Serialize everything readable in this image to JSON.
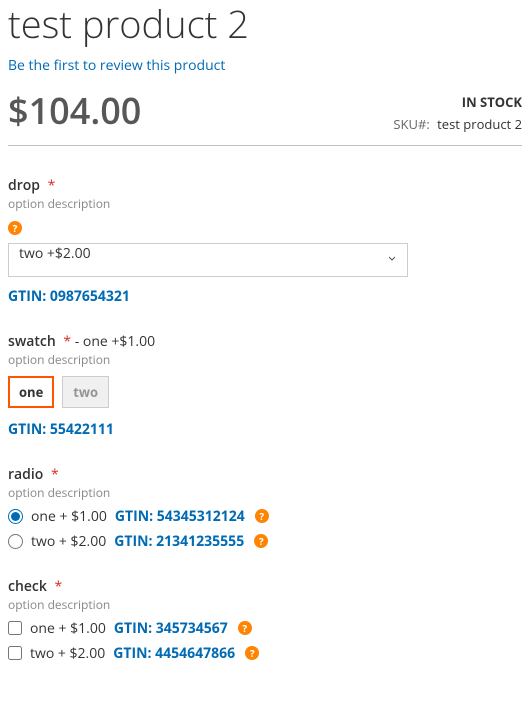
{
  "title": "test product 2",
  "review_link": "Be the first to review this product",
  "price": "$104.00",
  "stock": {
    "status": "IN STOCK",
    "sku_label": "SKU#:",
    "sku_value": "test product 2"
  },
  "options": {
    "drop": {
      "label": "drop",
      "desc": "option description",
      "selected": "two +$2.00",
      "gtin": "GTIN: 0987654321"
    },
    "swatch": {
      "label": "swatch",
      "extra": "- one +$1.00",
      "desc": "option description",
      "opt1": "one",
      "opt2": "two",
      "gtin": "GTIN: 55422111"
    },
    "radio": {
      "label": "radio",
      "desc": "option description",
      "items": [
        {
          "text": "one + $1.00",
          "gtin": "GTIN: 54345312124"
        },
        {
          "text": "two + $2.00",
          "gtin": "GTIN: 21341235555"
        }
      ]
    },
    "check": {
      "label": "check",
      "desc": "option description",
      "items": [
        {
          "text": "one + $1.00",
          "gtin": "GTIN: 345734567"
        },
        {
          "text": "two + $2.00",
          "gtin": "GTIN: 4454647866"
        }
      ]
    }
  }
}
